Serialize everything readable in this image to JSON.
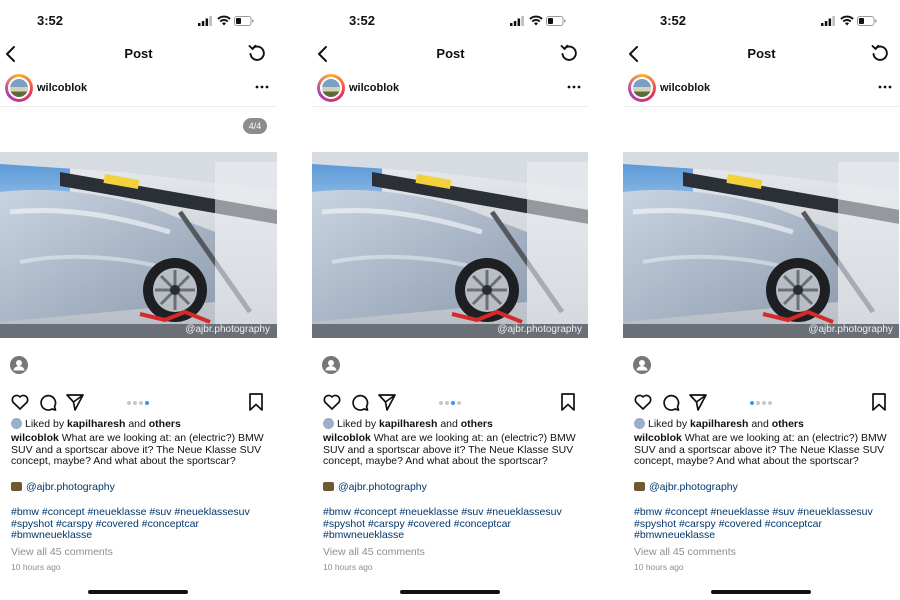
{
  "screens": [
    {
      "status": {
        "time": "3:52"
      },
      "header": {
        "title": "Post"
      },
      "post": {
        "username": "wilcoblok",
        "counter": "4/4",
        "watermark": "@ajbr.photography",
        "liked_prefix": "Liked by ",
        "liked_user": "kapilharesh",
        "liked_mid": " and ",
        "liked_others": "others",
        "caption_user": "wilcoblok",
        "caption_text": " What are we looking at: an (electric?) BMW SUV and a sportscar above it? The Neue Klasse SUV concept, maybe? And what about the sportscar?",
        "credit": "@ajbr.photography",
        "hashtags": "#bmw #concept #neueklasse #suv #neueklassesuv #spyshot #carspy #covered #conceptcar #bmwneueklasse",
        "view_all": "View all 45 comments",
        "time_ago": "10 hours ago",
        "carousel_index": 3,
        "carousel_total": 4
      }
    },
    {
      "status": {
        "time": "3:52"
      },
      "header": {
        "title": "Post"
      },
      "post": {
        "username": "wilcoblok",
        "watermark": "@ajbr.photography",
        "liked_prefix": "Liked by ",
        "liked_user": "kapilharesh",
        "liked_mid": " and ",
        "liked_others": "others",
        "caption_user": "wilcoblok",
        "caption_text": " What are we looking at: an (electric?) BMW SUV and a sportscar above it? The Neue Klasse SUV concept, maybe? And what about the sportscar?",
        "credit": "@ajbr.photography",
        "hashtags": "#bmw #concept #neueklasse #suv #neueklassesuv #spyshot #carspy #covered #conceptcar #bmwneueklasse",
        "view_all": "View all 45 comments",
        "time_ago": "10 hours ago",
        "carousel_index": 2,
        "carousel_total": 4
      }
    },
    {
      "status": {
        "time": "3:52"
      },
      "header": {
        "title": "Post"
      },
      "post": {
        "username": "wilcoblok",
        "watermark": "@ajbr.photography",
        "liked_prefix": "Liked by ",
        "liked_user": "kapilharesh",
        "liked_mid": " and ",
        "liked_others": "others",
        "caption_user": "wilcoblok",
        "caption_text": " What are we looking at: an (electric?) BMW SUV and a sportscar above it? The Neue Klasse SUV concept, maybe? And what about the sportscar?",
        "credit": "@ajbr.photography",
        "hashtags": "#bmw #concept #neueklasse #suv #neueklassesuv #spyshot #carspy #covered #conceptcar #bmwneueklasse",
        "view_all": "View all 45 comments",
        "time_ago": "10 hours ago",
        "carousel_index": 0,
        "carousel_total": 4
      }
    }
  ],
  "icons": {
    "back": "chevron-left-icon",
    "refresh": "refresh-icon",
    "more": "more-horizontal-icon",
    "tag": "user-tag-icon",
    "like": "heart-icon",
    "comment": "comment-icon",
    "share": "share-icon",
    "save": "bookmark-icon",
    "camera": "camera-icon"
  },
  "colors": {
    "link": "#00376b",
    "carousel_active": "#3897f0",
    "muted": "#8e8e8e"
  }
}
